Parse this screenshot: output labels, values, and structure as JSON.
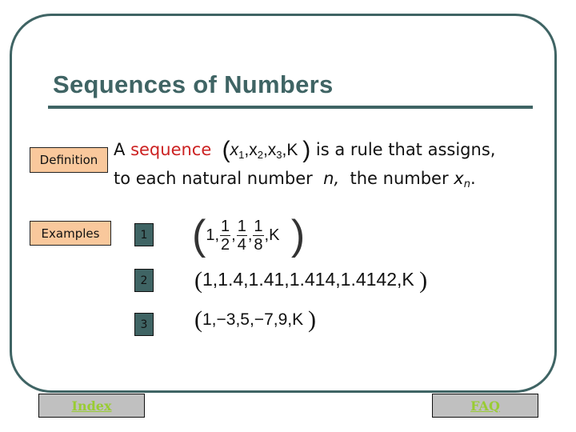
{
  "slide": {
    "title": "Sequences of Numbers",
    "colors": {
      "frame": "#3f6464",
      "tag_bg": "#f9c89c",
      "highlight": "#cc2222",
      "nav_bg": "#c0c0c0",
      "nav_text": "#99cc33"
    }
  },
  "definition": {
    "tag": "Definition",
    "line1": {
      "prefix": "A",
      "term": "sequence",
      "formula": {
        "items": [
          "x",
          "x",
          "x"
        ],
        "subs": [
          "1",
          "2",
          "3"
        ],
        "ellipsis": "K"
      },
      "suffix": "is a rule that assigns,"
    },
    "line2": {
      "text": "to each natural number",
      "var_n": "n,",
      "middle": "the number",
      "var_x": "x",
      "sub_n": "n",
      "end": "."
    }
  },
  "examples": {
    "tag": "Examples",
    "items": [
      {
        "number": "1",
        "first": "1,",
        "fractions": [
          {
            "num": "1",
            "den": "2"
          },
          {
            "num": "1",
            "den": "4"
          },
          {
            "num": "1",
            "den": "8"
          }
        ],
        "ellipsis": ",K"
      },
      {
        "number": "2",
        "text": "1,1.4,1.41,1.414,1.4142,K"
      },
      {
        "number": "3",
        "text": "1,−3,5,−7,9,K"
      }
    ]
  },
  "nav": {
    "index_label": "Index",
    "faq_label": "FAQ"
  }
}
